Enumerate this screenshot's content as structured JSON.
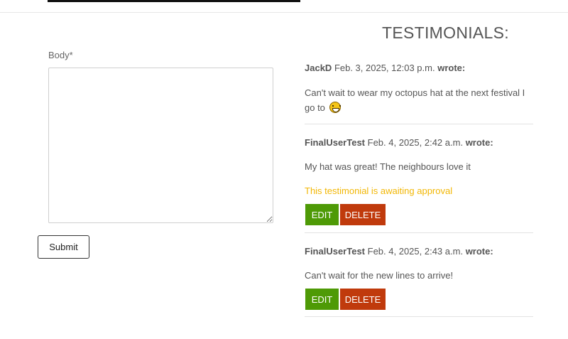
{
  "form": {
    "body_label": "Body*",
    "body_value": "",
    "submit_label": "Submit"
  },
  "testimonials": {
    "title": "TESTIMONIALS:",
    "wrote_label": "wrote:",
    "items": [
      {
        "author": "JackD",
        "date": "Feb. 3, 2025, 12:03 p.m.",
        "body": "Can't wait to wear my octopus hat at the next festival I go to",
        "emoji": "grinning-face-icon"
      },
      {
        "author": "FinalUserTest",
        "date": "Feb. 4, 2025, 2:42 a.m.",
        "body": "My hat was great! The neighbours love it",
        "pending": "This testimonial is awaiting approval",
        "edit_label": "EDIT",
        "delete_label": "DELETE"
      },
      {
        "author": "FinalUserTest",
        "date": "Feb. 4, 2025, 2:43 a.m.",
        "body": "Can't wait for the new lines to arrive!",
        "edit_label": "EDIT",
        "delete_label": "DELETE"
      }
    ]
  },
  "colors": {
    "edit_button": "#4e9a06",
    "delete_button": "#c03a0c",
    "pending_text": "#f2b705"
  }
}
